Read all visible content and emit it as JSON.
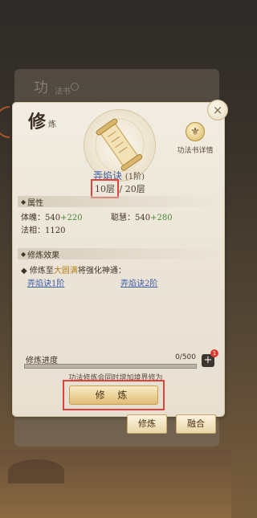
{
  "background": {
    "book_title": "功",
    "book_subtitle": "法书"
  },
  "panel": {
    "title": "修",
    "subtitle": "炼",
    "close_label": "×"
  },
  "skill": {
    "name": "弄焰诀",
    "tier": "(1阶)",
    "current_level": "10层",
    "max_level": "/ 20层"
  },
  "detail_button": {
    "label": "功法书详情",
    "icon": "trident-icon"
  },
  "attributes": {
    "header": "属性",
    "stats": [
      {
        "label": "体魄：",
        "base": "540",
        "bonus": "+220"
      },
      {
        "label": "聪慧：",
        "base": "540",
        "bonus": "+280"
      },
      {
        "label": "法相：",
        "base": "1120",
        "bonus": ""
      }
    ]
  },
  "effects": {
    "header": "修炼效果",
    "desc_prefix": "修炼至",
    "desc_highlight": "大圆满",
    "desc_suffix": "将强化神通：",
    "links": [
      "弄焰诀1阶",
      "弄焰诀2阶"
    ]
  },
  "progress": {
    "label": "修炼进度",
    "value_text": "0/500",
    "current": 0,
    "max": 500,
    "badge": "1"
  },
  "note": "功法修炼会同时增加境界修为",
  "cultivate_button": {
    "label": "修 炼"
  },
  "tabs": [
    {
      "label": "修炼"
    },
    {
      "label": "融合"
    }
  ],
  "colors": {
    "highlight_box": "#e2423c",
    "link_blue": "#3d5fa8",
    "bonus_green": "#4b8a3c",
    "gold": "#b37e1f"
  }
}
